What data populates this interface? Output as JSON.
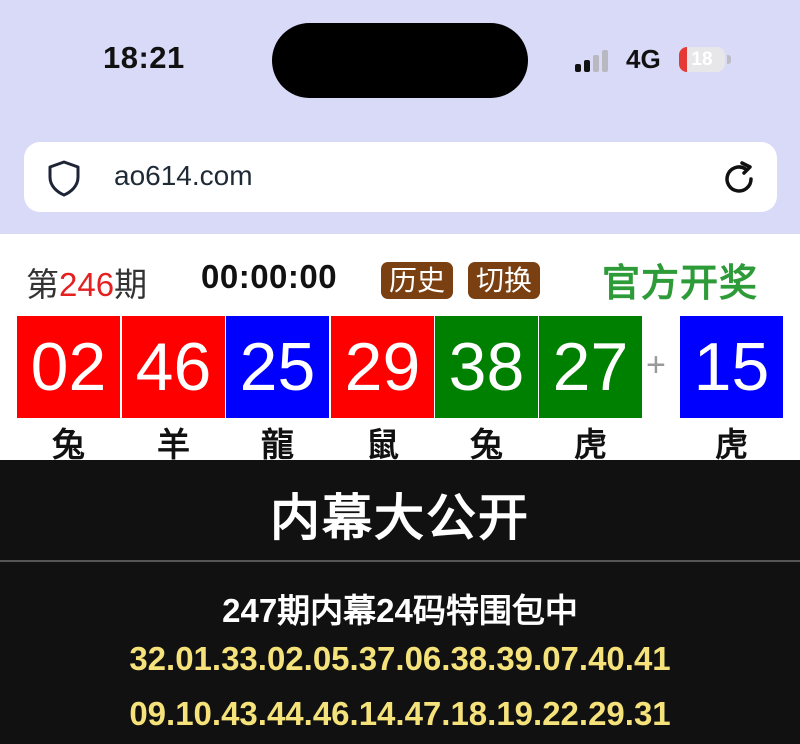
{
  "status_bar": {
    "time": "18:21",
    "network": "4G",
    "battery": "18",
    "battery_level": 0.18
  },
  "browser": {
    "url": "ao614.com"
  },
  "lottery": {
    "issue_prefix": "第",
    "issue_number": "246",
    "issue_suffix": "期",
    "countdown": "00:00:00",
    "history_label": "历史",
    "switch_label": "切换",
    "official_label": "官方开奖",
    "plus": "+",
    "balls": [
      {
        "number": "02",
        "zodiac": "兔",
        "color": "#ff0000"
      },
      {
        "number": "46",
        "zodiac": "羊",
        "color": "#ff0000"
      },
      {
        "number": "25",
        "zodiac": "龍",
        "color": "#0000ff"
      },
      {
        "number": "29",
        "zodiac": "鼠",
        "color": "#ff0000"
      },
      {
        "number": "38",
        "zodiac": "兔",
        "color": "#008000"
      },
      {
        "number": "27",
        "zodiac": "虎",
        "color": "#008000"
      }
    ],
    "special": {
      "number": "15",
      "zodiac": "虎",
      "color": "#0000ff"
    }
  },
  "banner": {
    "title": "内幕大公开",
    "subtitle": "247期内幕24码特围包中",
    "line1": "32.01.33.02.05.37.06.38.39.07.40.41",
    "line2": "09.10.43.44.46.14.47.18.19.22.29.31"
  }
}
